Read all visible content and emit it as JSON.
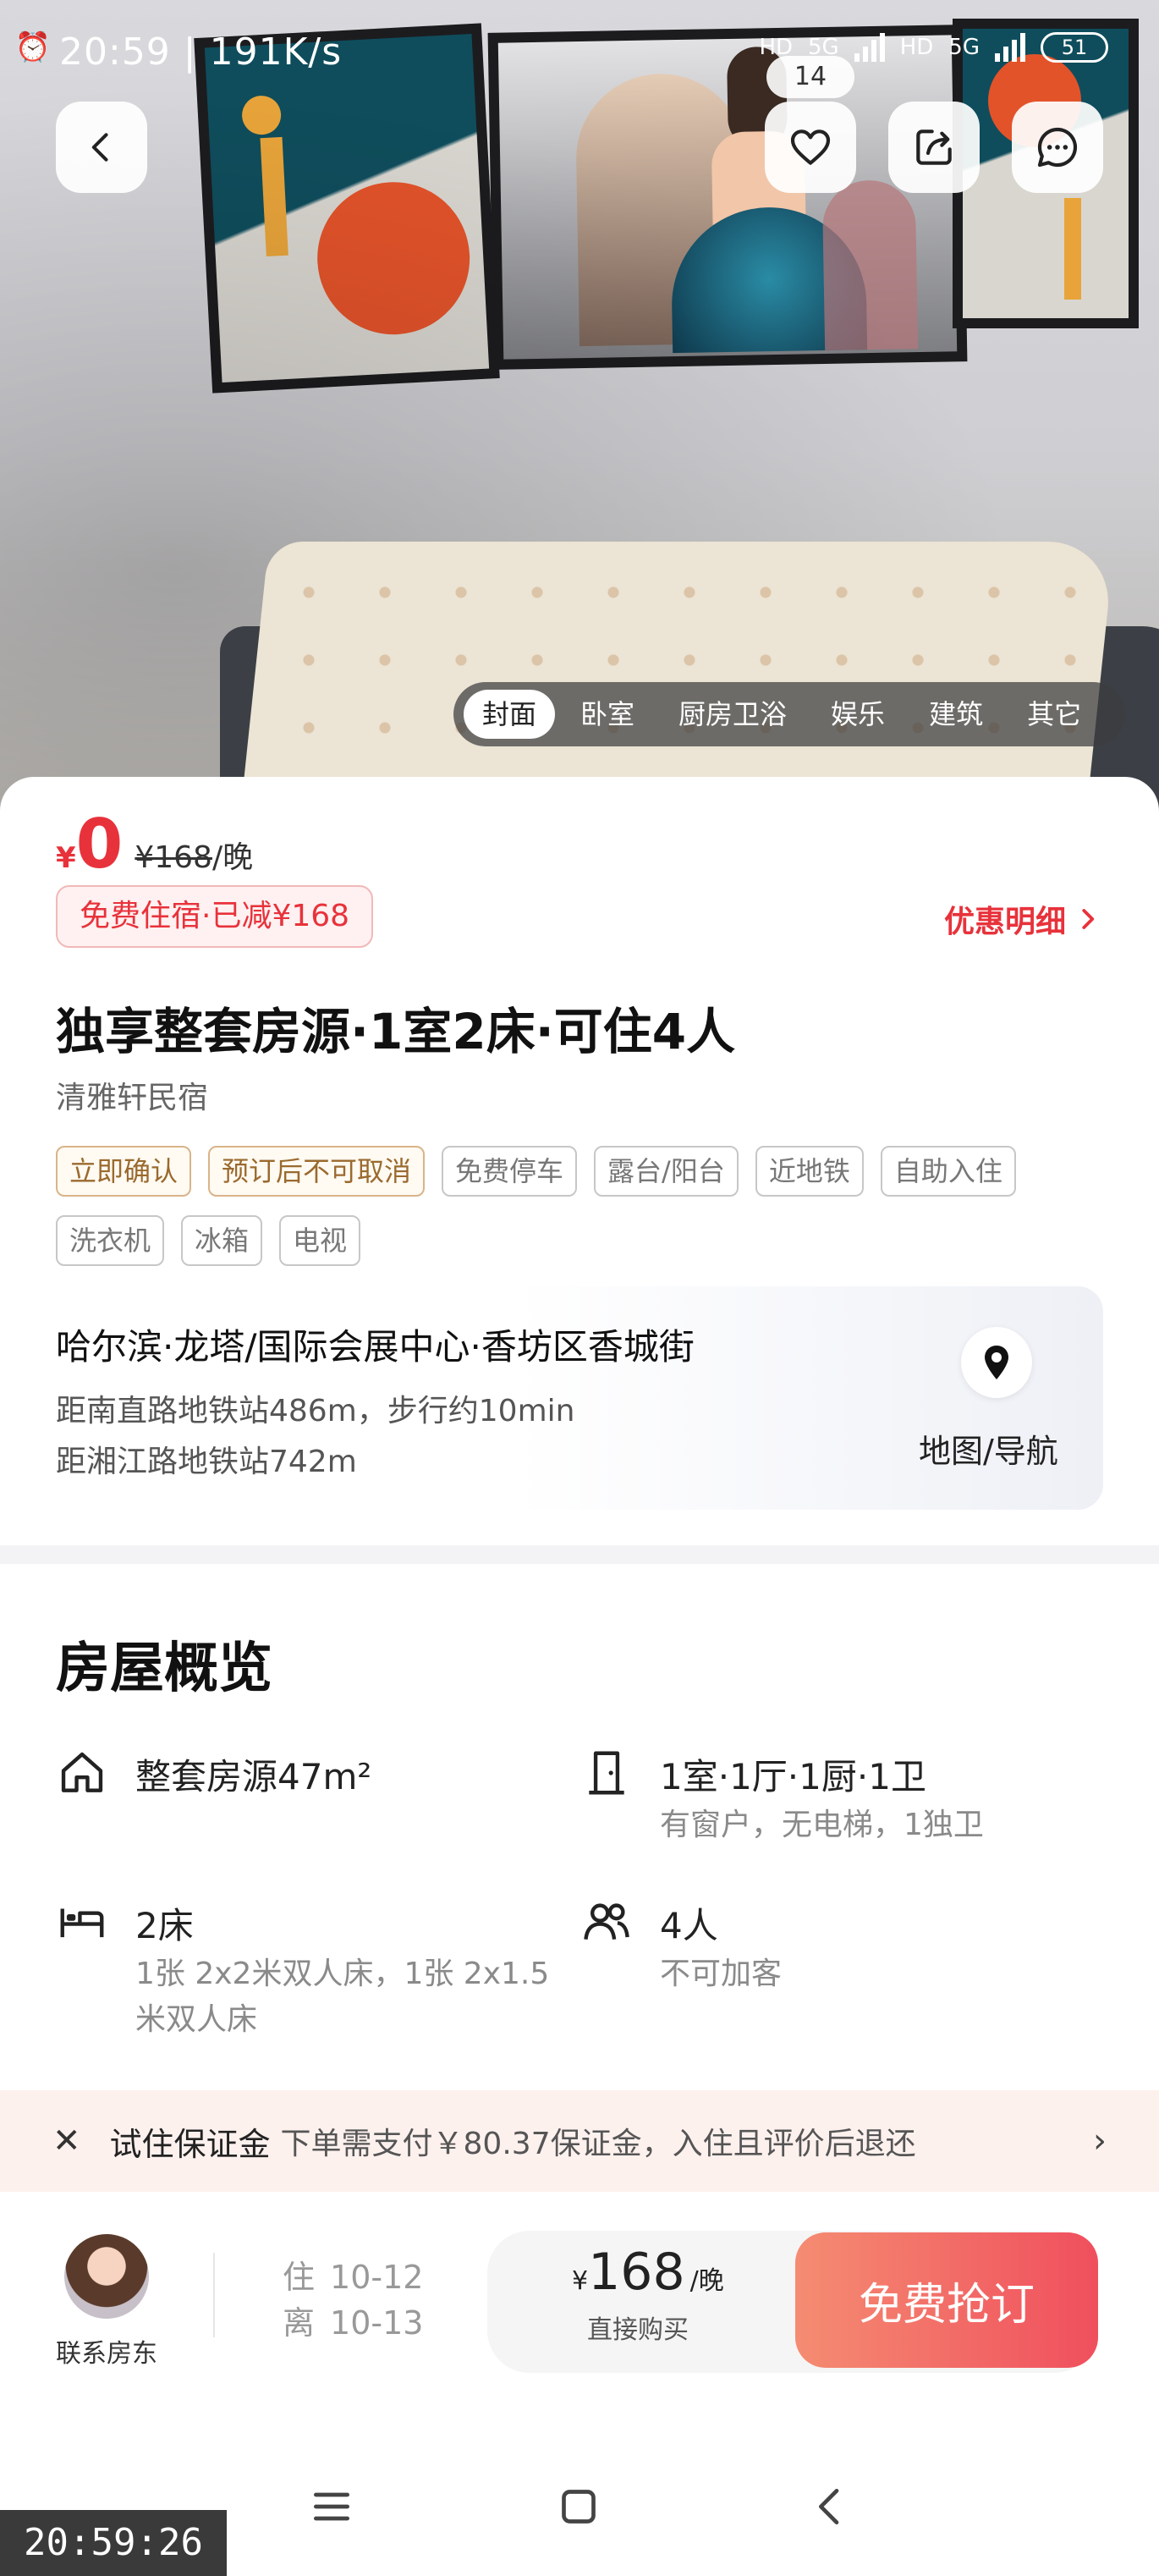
{
  "status_bar": {
    "time_speed": "20:59 | 191K/s",
    "hd1": "HD",
    "net1": "5G",
    "hd2": "HD",
    "net2": "5G",
    "battery": "51",
    "badge": "14"
  },
  "gallery": {
    "tabs": [
      "封面",
      "卧室",
      "厨房卫浴",
      "娱乐",
      "建筑",
      "其它"
    ],
    "active_tab": "封面"
  },
  "price": {
    "currency": "¥",
    "current": "0",
    "original": "¥168",
    "unit": "/晚",
    "promo_badge": "免费住宿·已减¥168",
    "promo_detail": "优惠明细"
  },
  "listing": {
    "title": "独享整套房源·1室2床·可住4人",
    "name": "清雅轩民宿",
    "tags": [
      {
        "label": "立即确认",
        "type": "warn"
      },
      {
        "label": "预订后不可取消",
        "type": "warn"
      },
      {
        "label": "免费停车",
        "type": "normal"
      },
      {
        "label": "露台/阳台",
        "type": "normal"
      },
      {
        "label": "近地铁",
        "type": "normal"
      },
      {
        "label": "自助入住",
        "type": "normal"
      },
      {
        "label": "洗衣机",
        "type": "normal"
      },
      {
        "label": "冰箱",
        "type": "normal"
      },
      {
        "label": "电视",
        "type": "normal"
      }
    ]
  },
  "location": {
    "address": "哈尔滨·龙塔/国际会展中心·香坊区香城街",
    "metro1": "距南直路地铁站486m，步行约10min",
    "metro2": "距湘江路地铁站742m",
    "map_label": "地图/导航"
  },
  "overview": {
    "title": "房屋概览",
    "area_main": "整套房源47m²",
    "rooms_main": "1室·1厅·1厨·1卫",
    "rooms_sub": "有窗户，无电梯，1独卫",
    "beds_main": "2床",
    "beds_sub_1": "1张 2x2米双人床，1张 2x1.5",
    "beds_sub_2": "米双人床",
    "guests_main": "4人",
    "guests_sub": "不可加客"
  },
  "deposit": {
    "label": "试住保证金",
    "desc": "下单需支付￥80.37保证金，入住且评价后退还"
  },
  "bottom_bar": {
    "contact": "联系房东",
    "checkin_label": "住",
    "checkin_date": "10-12",
    "checkout_label": "离",
    "checkout_date": "10-13",
    "yen": "¥",
    "price": "168",
    "unit": "/晚",
    "direct": "直接购买",
    "book": "免费抢订"
  },
  "timestamp": "20:59:26"
}
